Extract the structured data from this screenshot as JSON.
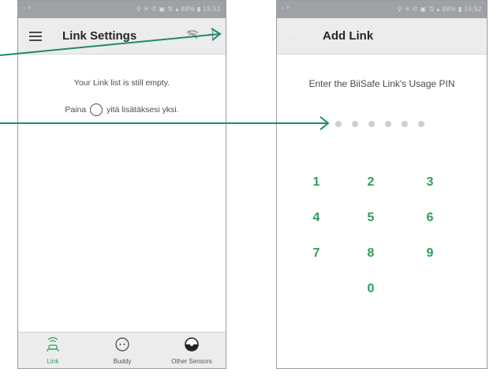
{
  "colors": {
    "accent": "#2e9d5b",
    "arrow": "#1f8a72",
    "appbar": "#ececec",
    "statusbar": "#9ea2a6"
  },
  "left": {
    "status_left": "▫ ᵇ",
    "status_right": "⚲ ✳ ✆ ▣ ⇅ ▴ 88% ▮ 15:51",
    "menu_icon": "hamburger-icon",
    "title": "Link Settings",
    "wifi_icon": "wifi-off-icon",
    "add_icon": "+",
    "empty_message": "Your Link list is still empty.",
    "hint_prefix": "Paina",
    "hint_suffix": "yitä lisätäksesi yksi.",
    "nav": [
      {
        "label": "Link",
        "icon": "link-icon",
        "active": true
      },
      {
        "label": "Buddy",
        "icon": "buddy-icon",
        "active": false
      },
      {
        "label": "Other Sensors",
        "icon": "sensors-icon",
        "active": false
      }
    ]
  },
  "right": {
    "status_left": "▫ ᵇ",
    "status_right": "⚲ ✳ ✆ ▣ ⇅ ▴ 88% ▮ 15:52",
    "back_icon": "←",
    "title": "Add Link",
    "pin_prompt": "Enter the BiiSafe Link's Usage PIN",
    "pin_length": 6,
    "keys": [
      "1",
      "2",
      "3",
      "4",
      "5",
      "6",
      "7",
      "8",
      "9",
      "0"
    ]
  }
}
